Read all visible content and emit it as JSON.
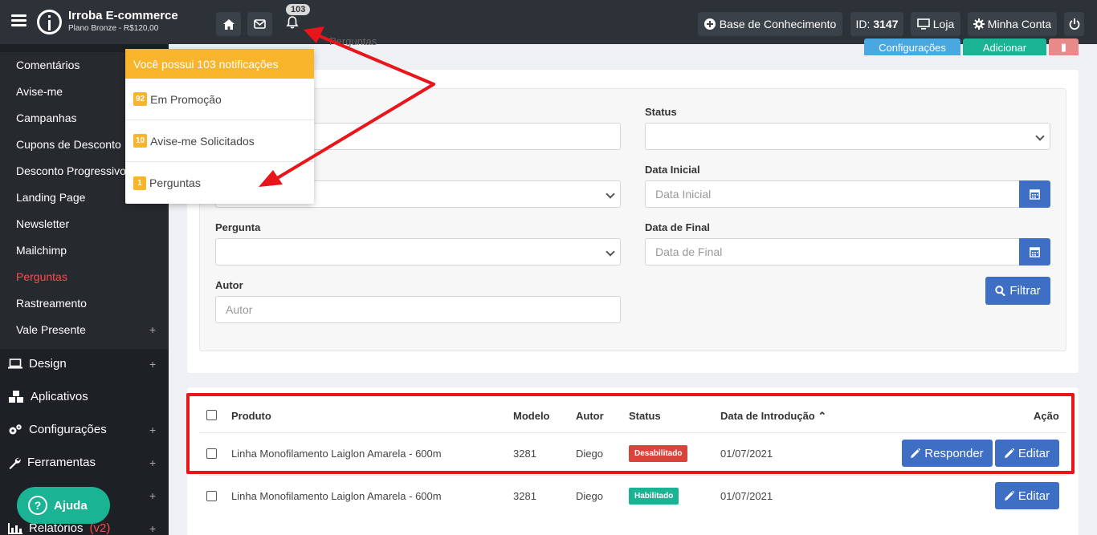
{
  "app": {
    "title": "Irroba E-commerce",
    "plan": "Plano Bronze - R$120,00"
  },
  "topbar": {
    "notif_count": "103",
    "knowledge_base": "Base de Conhecimento",
    "id_label": "ID:",
    "id_value": "3147",
    "store": "Loja",
    "account": "Minha Conta"
  },
  "sidebar": {
    "sub_items": [
      "Comentários",
      "Avise-me",
      "Campanhas",
      "Cupons de Desconto",
      "Desconto Progressivo",
      "Landing Page",
      "Newsletter",
      "Mailchimp",
      "Perguntas",
      "Rastreamento",
      "Vale Presente"
    ],
    "active_item": "Perguntas",
    "main_items": [
      "Design",
      "Aplicativos",
      "Configurações",
      "Ferramentas",
      "Relatórios"
    ],
    "reports_suffix": "(v2)"
  },
  "help_button": "Ajuda",
  "notifications": {
    "header": "Você possui 103 notificações",
    "items": [
      {
        "count": "92",
        "label": "Em Promoção"
      },
      {
        "count": "10",
        "label": "Avise-me Solicitados"
      },
      {
        "count": "1",
        "label": "Perguntas"
      }
    ]
  },
  "header_buttons": {
    "config": "Configurações",
    "add": "Adicionar"
  },
  "breadcrumb": "Perguntas",
  "filters": {
    "status_label": "Status",
    "start_date_label": "Data Inicial",
    "start_date_placeholder": "Data Inicial",
    "end_date_label": "Data de Final",
    "end_date_placeholder": "Data de Final",
    "question_label": "Pergunta",
    "author_label": "Autor",
    "author_placeholder": "Autor",
    "filter_button": "Filtrar"
  },
  "table": {
    "columns": [
      "Produto",
      "Modelo",
      "Autor",
      "Status",
      "Data de Introdução",
      "Ação"
    ],
    "rows": [
      {
        "product": "Linha Monofilamento Laiglon Amarela - 600m",
        "model": "3281",
        "author": "Diego",
        "status": "Desabilitado",
        "status_color": "#d9443a",
        "date": "01/07/2021",
        "actions": [
          "Responder",
          "Editar"
        ]
      },
      {
        "product": "Linha Monofilamento Laiglon Amarela - 600m",
        "model": "3281",
        "author": "Diego",
        "status": "Habilitado",
        "status_color": "#1ab394",
        "date": "01/07/2021",
        "actions": [
          "Editar"
        ]
      }
    ]
  },
  "colors": {
    "topbar": "#2d3238",
    "primary": "#3f6fc5",
    "warning": "#f8b52b",
    "success": "#1ab394",
    "danger": "#d9443a",
    "annotation": "#e8151b"
  }
}
